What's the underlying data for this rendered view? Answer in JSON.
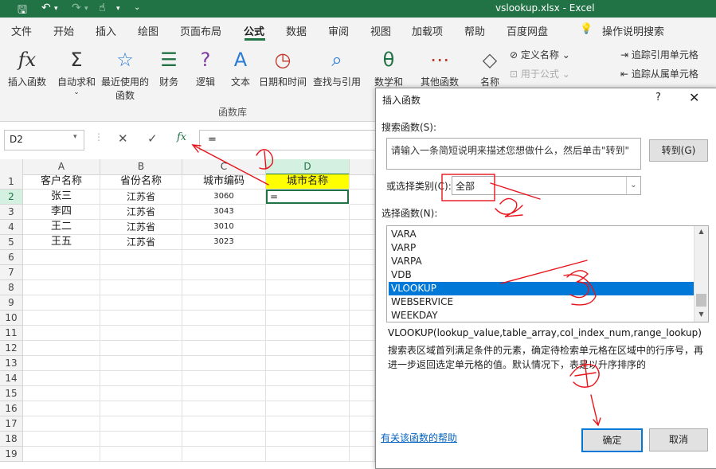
{
  "titlebar": {
    "title": "vslookup.xlsx  -  Excel",
    "save_icon": "save-icon",
    "undo_icon": "undo-icon",
    "redo_icon": "redo-icon",
    "touch_icon": "touch-mode-icon"
  },
  "menu": {
    "items": [
      "文件",
      "开始",
      "插入",
      "绘图",
      "页面布局",
      "公式",
      "数据",
      "审阅",
      "视图",
      "加载项",
      "帮助",
      "百度网盘"
    ],
    "active": "公式",
    "tell_me": "操作说明搜索",
    "accent": "#217346"
  },
  "ribbon": {
    "insert_function": "插入函数",
    "autosum": "自动求和",
    "recent": "最近使用的",
    "recent2": "函数",
    "financial": "财务",
    "logical": "逻辑",
    "text": "文本",
    "datetime": "日期和时间",
    "lookup": "查找与引用",
    "math": "数学和",
    "more": "其他函数",
    "group_label": "函数库",
    "name_manager": "名称",
    "define_name": "定义名称",
    "use_in_formula": "用于公式",
    "trace_precedents": "追踪引用单元格",
    "trace_dependents": "追踪从属单元格"
  },
  "formula_bar": {
    "name_box": "D2",
    "cancel": "✕",
    "enter": "✓",
    "fx": "fx",
    "content": "="
  },
  "sheet": {
    "columns": [
      "A",
      "B",
      "C",
      "D"
    ],
    "rows": [
      "1",
      "2",
      "3",
      "4",
      "5",
      "6",
      "7",
      "8",
      "9",
      "10",
      "11",
      "12",
      "13",
      "14",
      "15",
      "16",
      "17",
      "18",
      "19"
    ],
    "header": [
      "客户名称",
      "省份名称",
      "城市编码",
      "城市名称"
    ],
    "data": [
      [
        "张三",
        "江苏省",
        "3060",
        "="
      ],
      [
        "李四",
        "江苏省",
        "3043",
        ""
      ],
      [
        "王二",
        "江苏省",
        "3010",
        ""
      ],
      [
        "王五",
        "江苏省",
        "3023",
        ""
      ]
    ],
    "highlight_color": "#ffff00"
  },
  "dialog": {
    "title": "插入函数",
    "help": "?",
    "close": "✕",
    "search_label": "搜索函数(S):",
    "search_placeholder": "请输入一条简短说明来描述您想做什么，然后单击\"转到\"",
    "go_button": "转到(G)",
    "category_label": "或选择类别(C):",
    "category_value": "全部",
    "list_label": "选择函数(N):",
    "functions": [
      "VARA",
      "VARP",
      "VARPA",
      "VDB",
      "VLOOKUP",
      "WEBSERVICE",
      "WEEKDAY"
    ],
    "selected_function": "VLOOKUP",
    "signature": "VLOOKUP(lookup_value,table_array,col_index_num,range_lookup)",
    "description": "搜索表区域首列满足条件的元素，确定待检索单元格在区域中的行序号，再进一步返回选定单元格的值。默认情况下，表是以升序排序的",
    "help_link": "有关该函数的帮助",
    "ok": "确定",
    "cancel": "取消",
    "select_color": "#0078d7"
  },
  "annotations": {
    "color": "#e8141c",
    "marks": [
      "1",
      "2",
      "3",
      "4"
    ]
  }
}
